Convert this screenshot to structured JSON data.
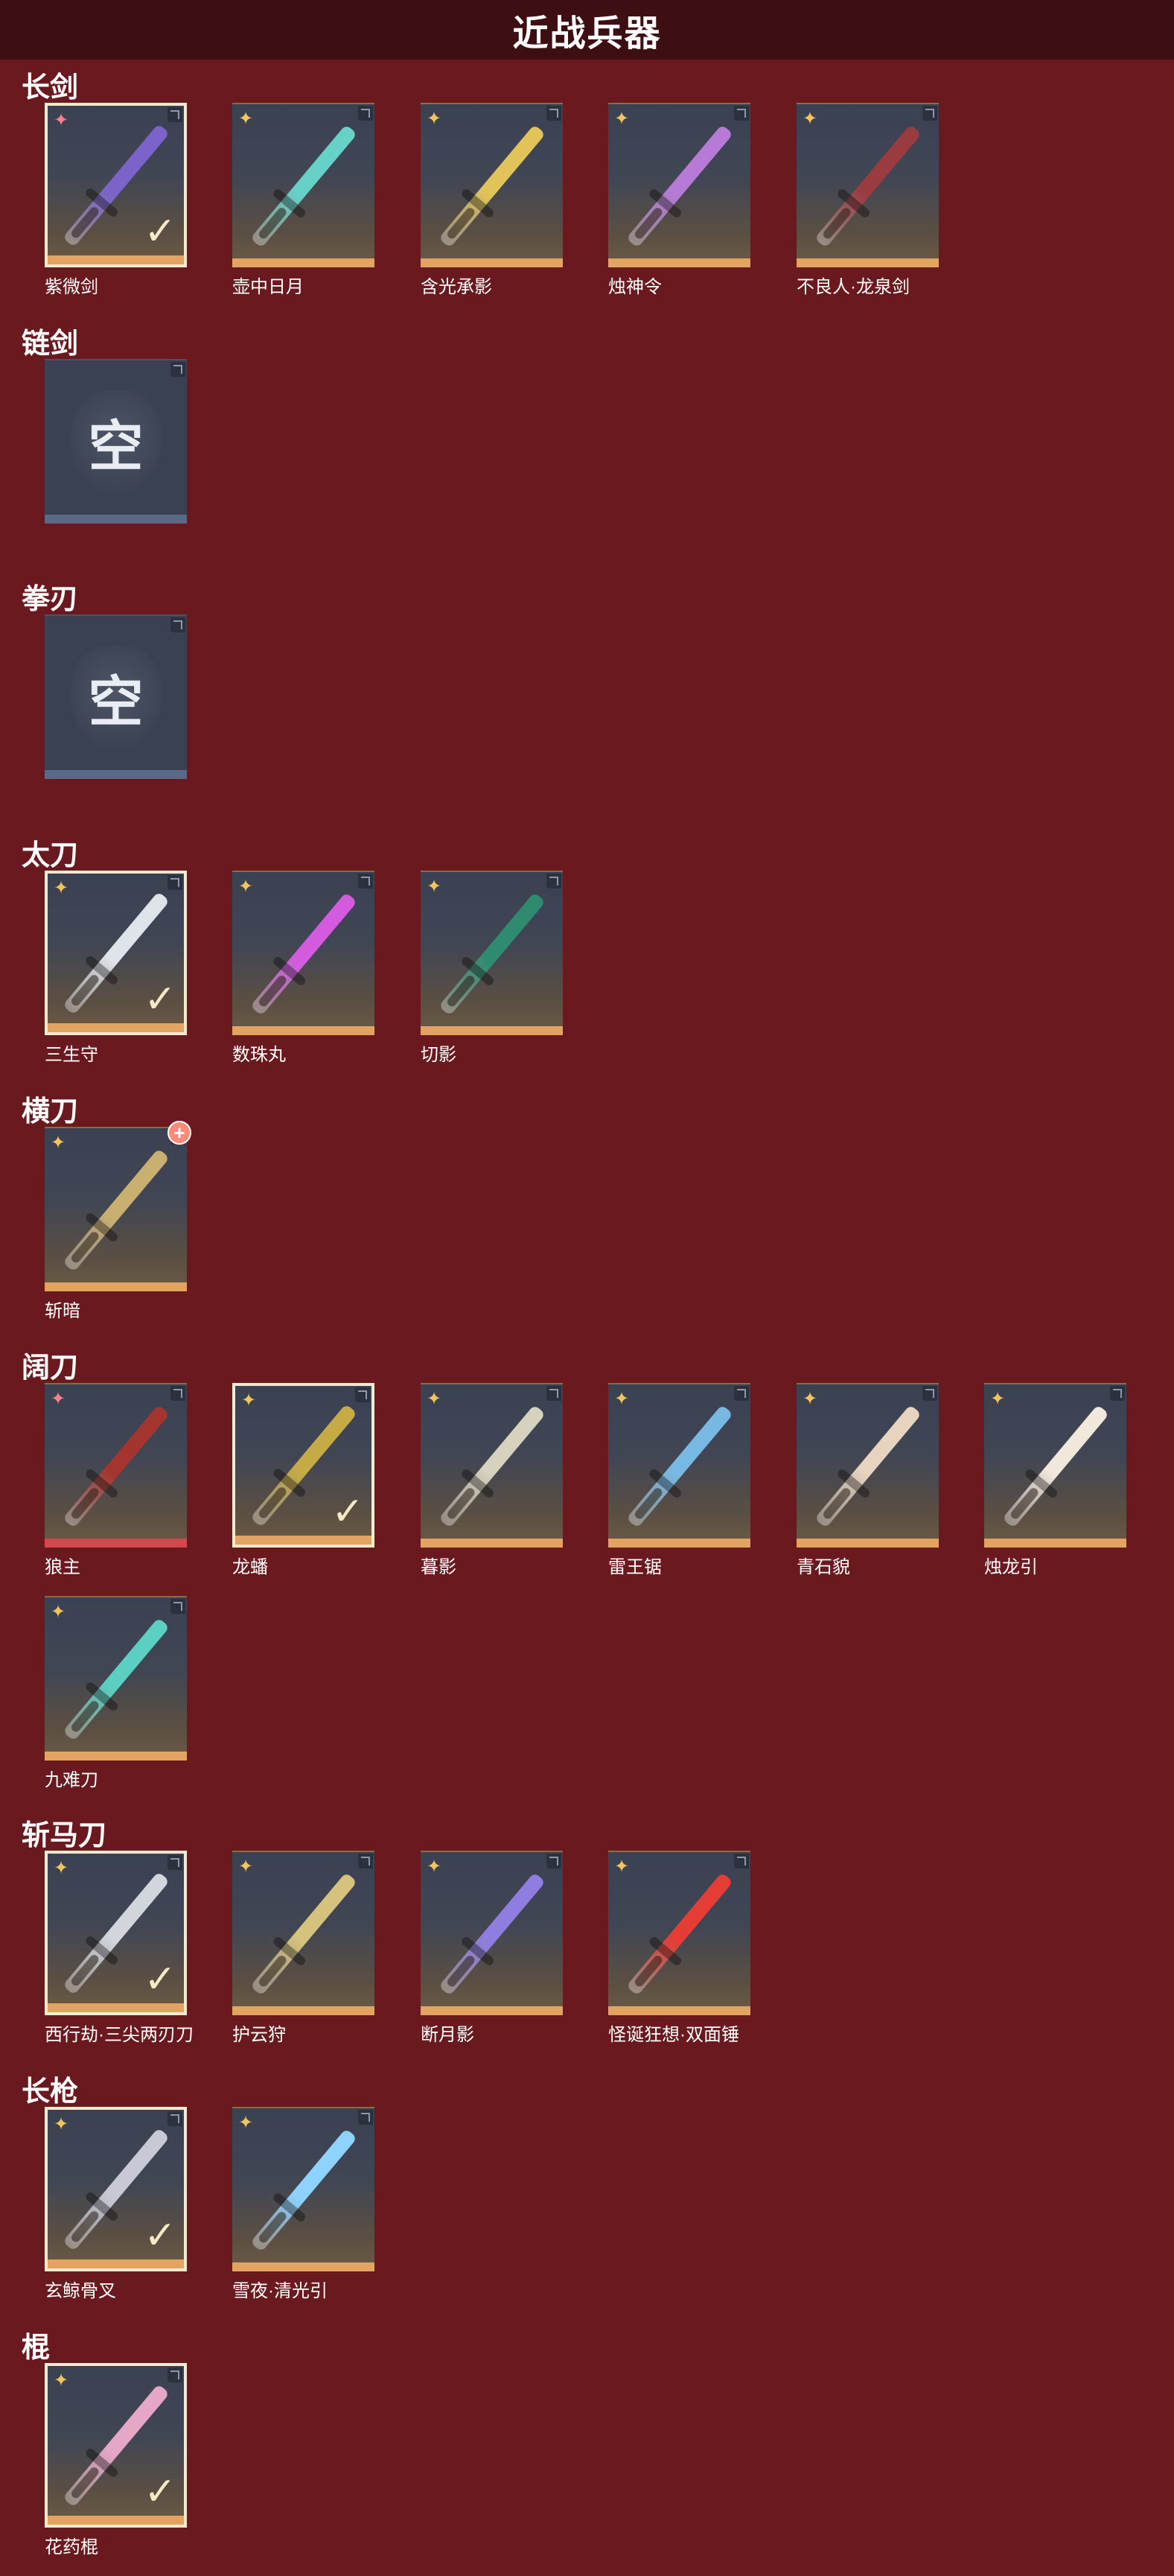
{
  "title": "近战兵器",
  "sections": [
    {
      "label": "长剑",
      "items": [
        {
          "name": "紫微剑",
          "rarity": "red",
          "selected": true,
          "color": "#7b63c9"
        },
        {
          "name": "壶中日月",
          "rarity": "gold",
          "selected": false,
          "color": "#66d1c7"
        },
        {
          "name": "含光承影",
          "rarity": "gold",
          "selected": false,
          "color": "#e2c35a"
        },
        {
          "name": "烛神令",
          "rarity": "gold",
          "selected": false,
          "color": "#b77ad6"
        },
        {
          "name": "不良人·龙泉剑",
          "rarity": "gold",
          "selected": false,
          "color": "#9a3b3f"
        }
      ]
    },
    {
      "label": "链剑",
      "items": [
        {
          "name": "",
          "empty": true,
          "empty_text": "空"
        }
      ]
    },
    {
      "label": "拳刃",
      "items": [
        {
          "name": "",
          "empty": true,
          "empty_text": "空"
        }
      ]
    },
    {
      "label": "太刀",
      "items": [
        {
          "name": "三生守",
          "rarity": "gold",
          "selected": true,
          "color": "#dfe3ea"
        },
        {
          "name": "数珠丸",
          "rarity": "gold",
          "selected": false,
          "color": "#d45be0"
        },
        {
          "name": "切影",
          "rarity": "gold",
          "selected": false,
          "color": "#2e8b6f"
        }
      ]
    },
    {
      "label": "横刀",
      "items": [
        {
          "name": "斩暗",
          "rarity": "gold",
          "selected": false,
          "badge": "+",
          "color": "#c9b070"
        }
      ]
    },
    {
      "label": "阔刀",
      "items": [
        {
          "name": "狼主",
          "rarity": "red",
          "selected": false,
          "bar": "red",
          "color": "#a4342e"
        },
        {
          "name": "龙蟠",
          "rarity": "gold",
          "selected": true,
          "color": "#c5aa46"
        },
        {
          "name": "暮影",
          "rarity": "gold",
          "selected": false,
          "color": "#d7d2bd"
        },
        {
          "name": "雷王锯",
          "rarity": "gold",
          "selected": false,
          "color": "#77b9e3"
        },
        {
          "name": "青石貌",
          "rarity": "gold",
          "selected": false,
          "color": "#e7d3be"
        },
        {
          "name": "烛龙引",
          "rarity": "gold",
          "selected": false,
          "color": "#f1e8dc"
        },
        {
          "name": "九难刀",
          "rarity": "gold",
          "selected": false,
          "color": "#5bd0c2"
        }
      ]
    },
    {
      "label": "斩马刀",
      "items": [
        {
          "name": "西行劫·三尖两刃刀",
          "rarity": "gold",
          "selected": true,
          "color": "#d2d6dc"
        },
        {
          "name": "护云狩",
          "rarity": "gold",
          "selected": false,
          "color": "#d5c27d"
        },
        {
          "name": "断月影",
          "rarity": "gold",
          "selected": false,
          "color": "#8f7de0"
        },
        {
          "name": "怪诞狂想·双面锤",
          "rarity": "gold",
          "selected": false,
          "color": "#e53c36"
        }
      ]
    },
    {
      "label": "长枪",
      "items": [
        {
          "name": "玄鲸骨叉",
          "rarity": "gold",
          "selected": true,
          "color": "#c9c9d6"
        },
        {
          "name": "雪夜·清光引",
          "rarity": "gold",
          "selected": false,
          "color": "#8ed3ff"
        }
      ]
    },
    {
      "label": "棍",
      "items": [
        {
          "name": "花药棍",
          "rarity": "gold",
          "selected": true,
          "color": "#e6a7c7"
        }
      ]
    }
  ],
  "icons": {
    "rarity_gold": "four-point-star-icon",
    "rarity_red": "four-point-star-icon",
    "selected_check": "check-icon",
    "empty_slot": "empty-slot-icon",
    "badge": "plus-badge-icon",
    "corner": "corner-tab-icon"
  },
  "colors": {
    "background": "#6a1a1e",
    "title_bar": "#3d0f12",
    "rarity_gold": "#f3c45a",
    "rarity_red": "#ff7f8a",
    "bar_gold": "#e3a361",
    "bar_red": "#d04a4d",
    "selected_border": "#f4ead2"
  }
}
